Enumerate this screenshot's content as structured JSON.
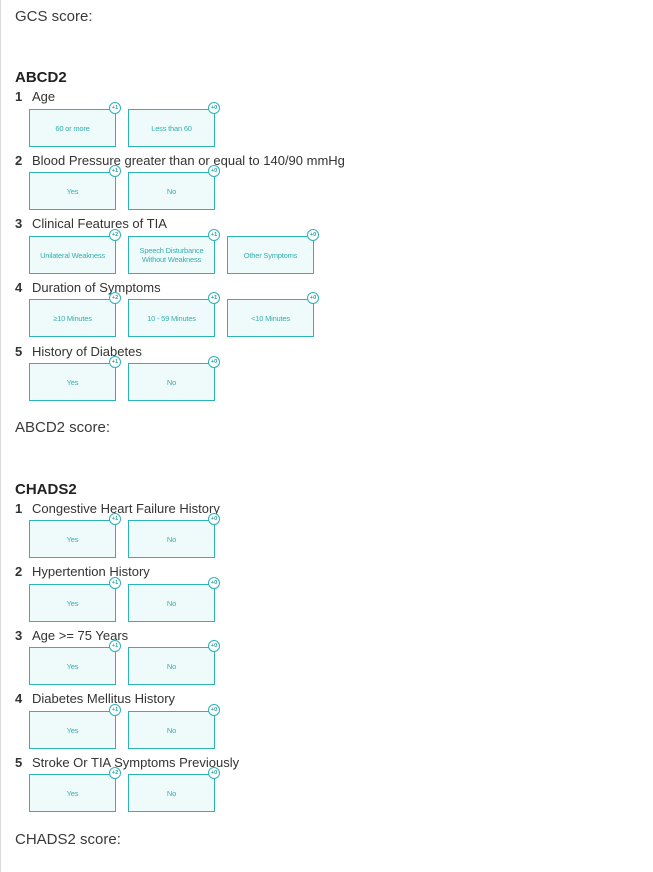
{
  "gcs_score_label": "GCS score:",
  "abcd2": {
    "title": "ABCD2",
    "score_label": "ABCD2 score:",
    "questions": [
      {
        "num": "1",
        "text": "Age",
        "options": [
          {
            "label": "60 or more",
            "points": "+1"
          },
          {
            "label": "Less than 60",
            "points": "+0"
          }
        ]
      },
      {
        "num": "2",
        "text": "Blood Pressure greater than or equal to 140/90 mmHg",
        "options": [
          {
            "label": "Yes",
            "points": "+1"
          },
          {
            "label": "No",
            "points": "+0"
          }
        ]
      },
      {
        "num": "3",
        "text": "Clinical Features of TIA",
        "options": [
          {
            "label": "Unilateral Weakness",
            "points": "+2"
          },
          {
            "label": "Speech Disturbance Without Weakness",
            "points": "+1"
          },
          {
            "label": "Other Symptoms",
            "points": "+0"
          }
        ]
      },
      {
        "num": "4",
        "text": "Duration of Symptoms",
        "options": [
          {
            "label": "≥10 Minutes",
            "points": "+2"
          },
          {
            "label": "10 - 59 Minutes",
            "points": "+1"
          },
          {
            "label": "<10 Minutes",
            "points": "+0"
          }
        ]
      },
      {
        "num": "5",
        "text": "History of Diabetes",
        "options": [
          {
            "label": "Yes",
            "points": "+1"
          },
          {
            "label": "No",
            "points": "+0"
          }
        ]
      }
    ]
  },
  "chads2": {
    "title": "CHADS2",
    "score_label": "CHADS2 score:",
    "questions": [
      {
        "num": "1",
        "text": "Congestive Heart Failure History",
        "options": [
          {
            "label": "Yes",
            "points": "+1"
          },
          {
            "label": "No",
            "points": "+0"
          }
        ]
      },
      {
        "num": "2",
        "text": "Hypertention History",
        "options": [
          {
            "label": "Yes",
            "points": "+1"
          },
          {
            "label": "No",
            "points": "+0"
          }
        ]
      },
      {
        "num": "3",
        "text": "Age >= 75 Years",
        "options": [
          {
            "label": "Yes",
            "points": "+1"
          },
          {
            "label": "No",
            "points": "+0"
          }
        ]
      },
      {
        "num": "4",
        "text": "Diabetes Mellitus History",
        "options": [
          {
            "label": "Yes",
            "points": "+1"
          },
          {
            "label": "No",
            "points": "+0"
          }
        ]
      },
      {
        "num": "5",
        "text": "Stroke Or TIA Symptoms Previously",
        "options": [
          {
            "label": "Yes",
            "points": "+2"
          },
          {
            "label": "No",
            "points": "+0"
          }
        ]
      }
    ]
  }
}
